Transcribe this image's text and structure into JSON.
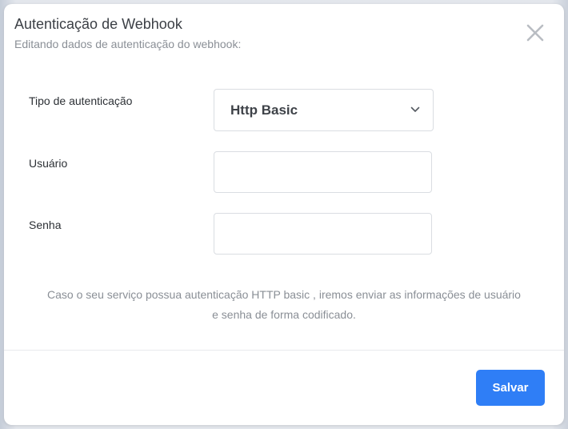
{
  "modal": {
    "title": "Autenticação de Webhook",
    "subtitle": "Editando dados de autenticação do webhook:",
    "close_icon": "close-icon"
  },
  "form": {
    "auth_type": {
      "label": "Tipo de autenticação",
      "selected": "Http Basic"
    },
    "user": {
      "label": "Usuário",
      "value": ""
    },
    "password": {
      "label": "Senha",
      "value": ""
    }
  },
  "info": {
    "line1": "Caso o seu serviço possua autenticação HTTP basic , iremos enviar as informações de usuário",
    "line2": "e senha de forma codificado."
  },
  "footer": {
    "save_label": "Salvar"
  },
  "colors": {
    "accent": "#2f7ef6",
    "title": "#3b3f45",
    "muted": "#8a8f96",
    "border": "#dadde2"
  }
}
